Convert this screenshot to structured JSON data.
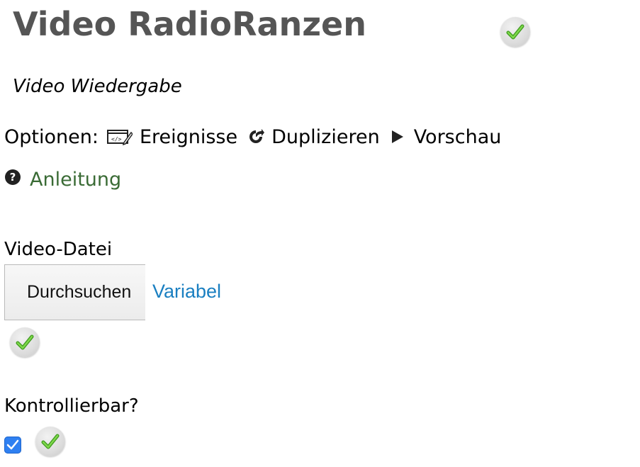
{
  "header": {
    "title": "Video RadioRanzen",
    "status_icon": "green-check-icon",
    "subtitle": "Video Wiedergabe"
  },
  "options": {
    "label": "Optionen:",
    "items": [
      {
        "label": "Ereignisse",
        "icon": "code-edit-icon"
      },
      {
        "label": "Duplizieren",
        "icon": "share-icon"
      },
      {
        "label": "Vorschau",
        "icon": "play-icon"
      }
    ]
  },
  "help": {
    "icon": "question-circle-icon",
    "label": "Anleitung"
  },
  "video_file": {
    "label": "Video-Datei",
    "browse_button": "Durchsuchen",
    "variable_link": "Variabel",
    "status_icon": "green-check-icon"
  },
  "controllable": {
    "label": "Kontrollierbar?",
    "checked": true,
    "status_icon": "green-check-icon"
  },
  "colors": {
    "title": "#555555",
    "help_link": "#3a6b35",
    "variable_link": "#1a7fc1",
    "checkbox": "#2f80f1",
    "check_green": "#6cc93a"
  }
}
